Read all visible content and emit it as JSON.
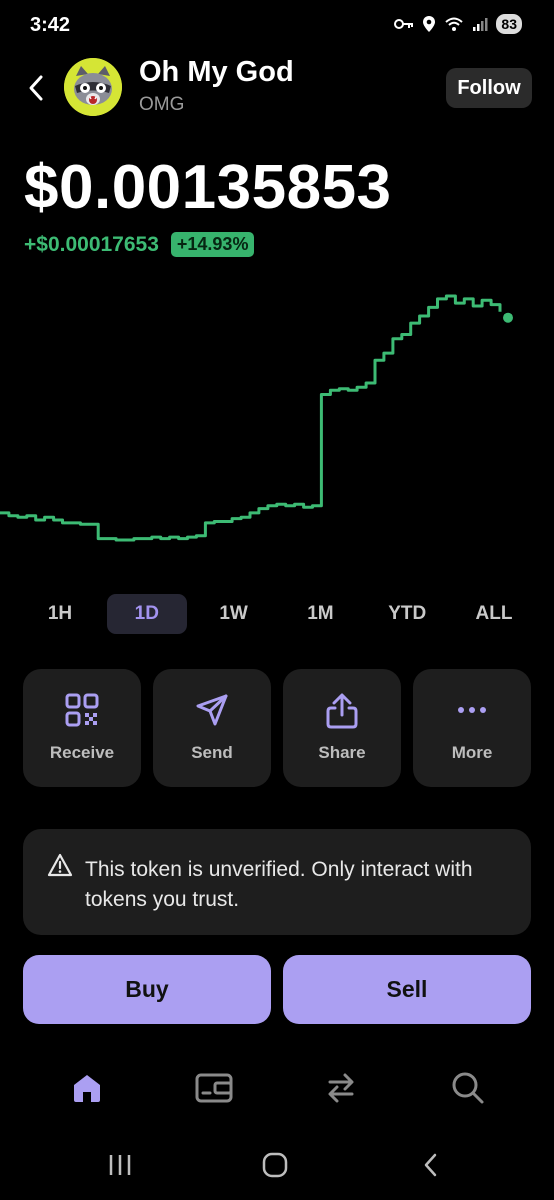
{
  "status_bar": {
    "time": "3:42",
    "battery": "83"
  },
  "header": {
    "token_name": "Oh My God",
    "token_symbol": "OMG",
    "follow_label": "Follow"
  },
  "price": {
    "value": "$0.00135853",
    "change_abs": "+$0.00017653",
    "change_pct": "+14.93%"
  },
  "colors": {
    "accent": "#ab9ff2",
    "positive": "#3dbb74",
    "background": "#000000",
    "card": "#1e1e1e"
  },
  "timeframes": [
    {
      "label": "1H"
    },
    {
      "label": "1D",
      "active": true
    },
    {
      "label": "1W"
    },
    {
      "label": "1M"
    },
    {
      "label": "YTD"
    },
    {
      "label": "ALL"
    }
  ],
  "actions": [
    {
      "label": "Receive",
      "icon": "qr-code-icon"
    },
    {
      "label": "Send",
      "icon": "send-icon"
    },
    {
      "label": "Share",
      "icon": "share-icon"
    },
    {
      "label": "More",
      "icon": "more-icon"
    }
  ],
  "warning": {
    "icon": "warning-triangle-icon",
    "text": "This token is unverified. Only interact with tokens you trust."
  },
  "trade": {
    "buy_label": "Buy",
    "sell_label": "Sell"
  },
  "bottom_nav": [
    {
      "icon": "home-icon",
      "active": true
    },
    {
      "icon": "wallet-icon"
    },
    {
      "icon": "swap-icon"
    },
    {
      "icon": "search-icon"
    }
  ],
  "chart_data": {
    "type": "line",
    "timeframe": "1D",
    "color": "#3dbb74",
    "values": [
      1.165,
      1.163,
      1.162,
      1.163,
      1.16,
      1.162,
      1.16,
      1.158,
      1.158,
      1.157,
      1.157,
      1.147,
      1.147,
      1.146,
      1.146,
      1.147,
      1.147,
      1.148,
      1.147,
      1.148,
      1.147,
      1.148,
      1.149,
      1.158,
      1.159,
      1.159,
      1.161,
      1.162,
      1.165,
      1.168,
      1.17,
      1.171,
      1.17,
      1.171,
      1.169,
      1.17,
      1.248,
      1.251,
      1.252,
      1.251,
      1.253,
      1.256,
      1.272,
      1.277,
      1.287,
      1.29,
      1.298,
      1.303,
      1.309,
      1.315,
      1.317,
      1.312,
      1.315,
      1.31,
      1.314,
      1.311,
      1.306
    ]
  }
}
